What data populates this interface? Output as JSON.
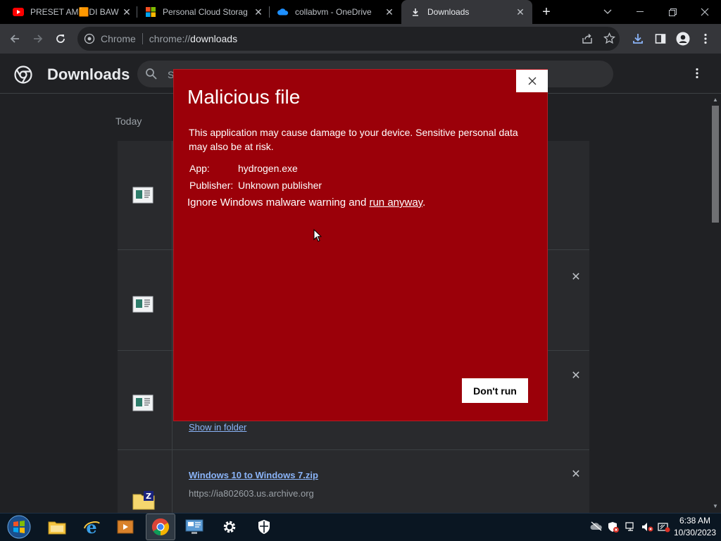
{
  "tabs": [
    {
      "title": "PRESET AM🟧DI BAW",
      "icon": "youtube-icon",
      "active": false
    },
    {
      "title": "Personal Cloud Storag",
      "icon": "microsoft-icon",
      "active": false
    },
    {
      "title": "collabvm - OneDrive",
      "icon": "onedrive-icon",
      "active": false
    },
    {
      "title": "Downloads",
      "icon": "download-icon",
      "active": true
    }
  ],
  "omnibox": {
    "chip": "Chrome",
    "url_prefix": "chrome://",
    "url_path": "downloads"
  },
  "page": {
    "title": "Downloads",
    "search_placeholder": "S",
    "date_label": "Today"
  },
  "downloads": {
    "show_folder_label": "Show in folder",
    "last_item": {
      "filename": "Windows 10 to Windows 7.zip",
      "url": "https://ia802603.us.archive.org"
    }
  },
  "dialog": {
    "title": "Malicious file",
    "message": "This application may cause damage to your device. Sensitive personal data may also be at risk.",
    "app_label": "App:",
    "app_value": "hydrogen.exe",
    "publisher_label": "Publisher:",
    "publisher_value": "Unknown publisher",
    "ignore_prefix": "Ignore Windows malware warning and ",
    "run_anyway": "run anyway",
    "ignore_suffix": ".",
    "dont_run": "Don't run",
    "accent": "#9b0009"
  },
  "taskbar": {
    "time": "6:38 AM",
    "date": "10/30/2023"
  }
}
